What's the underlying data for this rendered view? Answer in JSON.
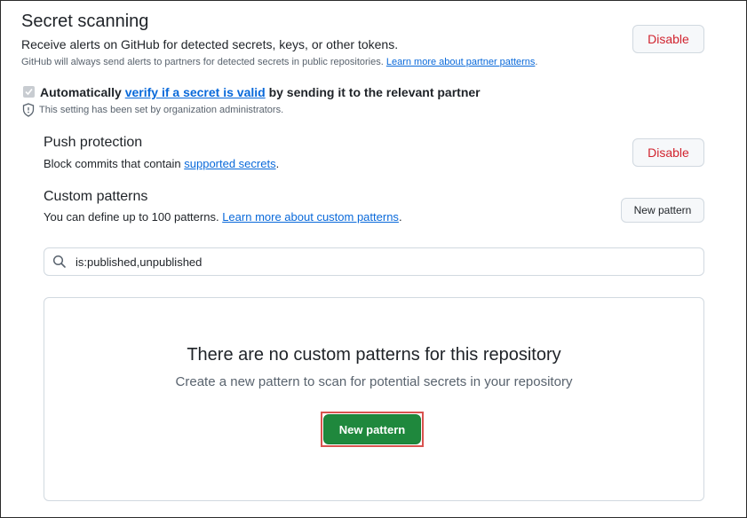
{
  "secret_scanning": {
    "title": "Secret scanning",
    "description": "Receive alerts on GitHub for detected secrets, keys, or other tokens.",
    "note_prefix": "GitHub will always send alerts to partners for detected secrets in public repositories.",
    "note_link": "Learn more about partner patterns",
    "note_suffix": ".",
    "disable_label": "Disable"
  },
  "validity": {
    "checked": true,
    "label_prefix": "Automatically",
    "label_link": "verify if a secret is valid",
    "label_suffix": "by sending it to the relevant partner",
    "admin_note": "This setting has been set by organization administrators."
  },
  "push_protection": {
    "title": "Push protection",
    "desc_prefix": "Block commits that contain",
    "desc_link": "supported secrets",
    "desc_suffix": ".",
    "disable_label": "Disable"
  },
  "custom_patterns": {
    "title": "Custom patterns",
    "desc_prefix": "You can define up to 100 patterns.",
    "desc_link": "Learn more about custom patterns",
    "desc_suffix": ".",
    "new_pattern_label": "New pattern"
  },
  "search": {
    "value": "is:published,unpublished"
  },
  "blankslate": {
    "title": "There are no custom patterns for this repository",
    "description": "Create a new pattern to scan for potential secrets in your repository",
    "button_label": "New pattern"
  },
  "colors": {
    "link": "#0969da",
    "danger": "#d1242f",
    "primary": "#1f883d",
    "highlight": "#d9534f"
  }
}
